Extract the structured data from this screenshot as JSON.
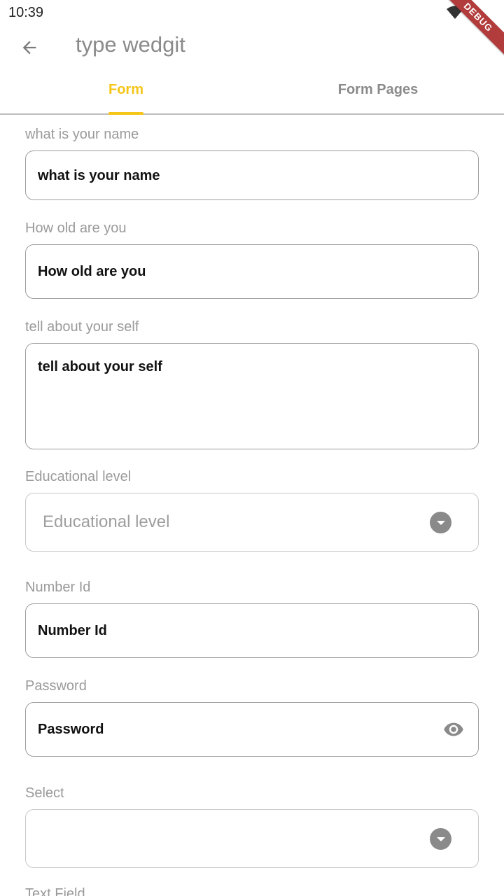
{
  "status_bar": {
    "time": "10:39"
  },
  "debug_banner": "DEBUG",
  "app_bar": {
    "title": "type wedgit"
  },
  "tabs": [
    {
      "label": "Form",
      "active": true
    },
    {
      "label": "Form Pages",
      "active": false
    }
  ],
  "colors": {
    "accent": "#f5c518",
    "muted": "#8a8a8a",
    "border": "#9e9e9e",
    "debug": "#b23b3b"
  },
  "form": {
    "name": {
      "label": "what is your name",
      "value": "what is your name"
    },
    "age": {
      "label": "How old are you",
      "value": "How old are you"
    },
    "about": {
      "label": "tell about your self",
      "value": "tell about your self"
    },
    "education": {
      "label": "Educational level",
      "placeholder": "Educational level"
    },
    "number_id": {
      "label": "Number Id",
      "value": "Number Id"
    },
    "password": {
      "label": "Password",
      "value": "Password",
      "icon": "eye-icon"
    },
    "select": {
      "label": "Select",
      "value": ""
    },
    "text_field": {
      "label": "Text Field"
    }
  }
}
